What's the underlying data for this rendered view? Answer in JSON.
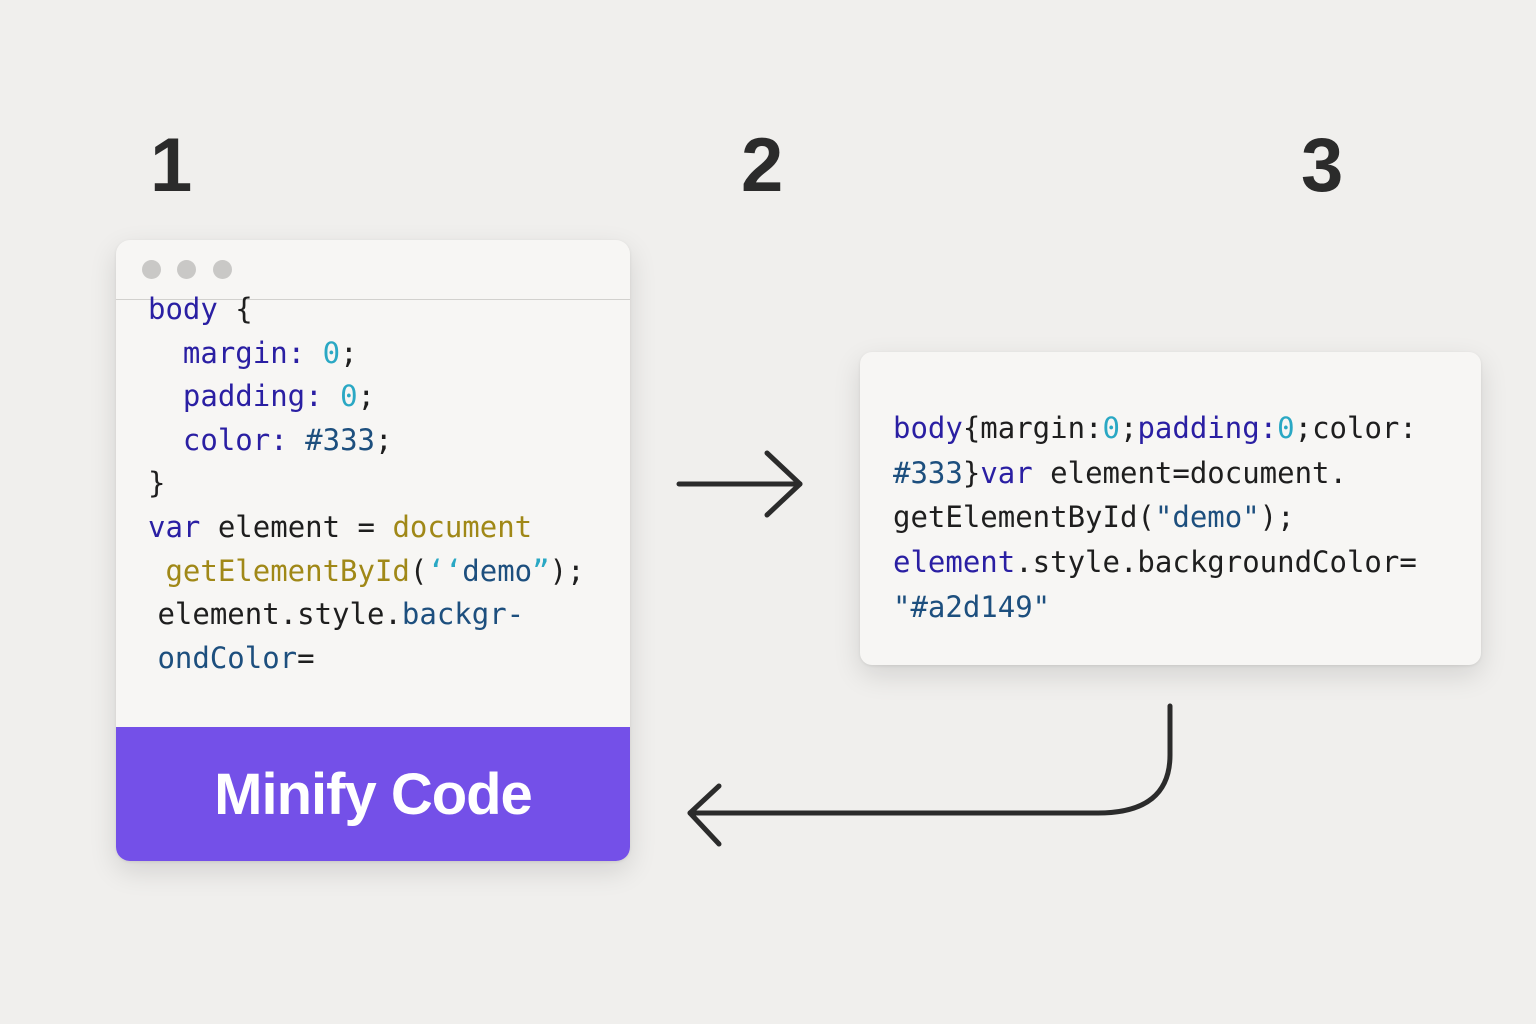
{
  "steps": [
    "1",
    "2",
    "3"
  ],
  "editor": {
    "window_dots": 3,
    "lines": [
      [
        {
          "t": "body",
          "c": "kw"
        },
        {
          "t": " {",
          "c": "plain"
        }
      ],
      [
        {
          "t": "  margin:",
          "c": "kw"
        },
        {
          "t": " 0",
          "c": "num"
        },
        {
          "t": ";",
          "c": "plain"
        }
      ],
      [
        {
          "t": "  padding:",
          "c": "kw"
        },
        {
          "t": " 0",
          "c": "num"
        },
        {
          "t": ";",
          "c": "plain"
        }
      ],
      [
        {
          "t": "  color:",
          "c": "kw"
        },
        {
          "t": " #333",
          "c": "hex"
        },
        {
          "t": ";",
          "c": "plain"
        }
      ],
      [
        {
          "t": "}",
          "c": "plain"
        }
      ],
      [
        {
          "t": "var",
          "c": "kw"
        },
        {
          "t": " element = ",
          "c": "plain"
        },
        {
          "t": "document",
          "c": "doc"
        }
      ],
      [
        {
          "t": " getElementById",
          "c": "doc"
        },
        {
          "t": "(",
          "c": "plain"
        },
        {
          "t": "‘‘",
          "c": "q"
        },
        {
          "t": "demo",
          "c": "str"
        },
        {
          "t": "”",
          "c": "q"
        },
        {
          "t": ");",
          "c": "plain"
        }
      ],
      [
        {
          "t": " element.style.",
          "c": "plain"
        },
        {
          "t": "backgr-",
          "c": "prop"
        }
      ],
      [
        {
          "t": " ondColor",
          "c": "prop"
        },
        {
          "t": "=",
          "c": "plain"
        }
      ]
    ],
    "button_label": "Minify Code"
  },
  "output": {
    "lines": [
      [
        {
          "t": "body",
          "c": "kw"
        },
        {
          "t": "{margin:",
          "c": "plain"
        },
        {
          "t": "0",
          "c": "num"
        },
        {
          "t": ";",
          "c": "plain"
        },
        {
          "t": "padding:",
          "c": "kw"
        },
        {
          "t": "0",
          "c": "num"
        },
        {
          "t": ";color:",
          "c": "plain"
        }
      ],
      [
        {
          "t": "#333",
          "c": "hex"
        },
        {
          "t": "}",
          "c": "plain"
        },
        {
          "t": "var",
          "c": "kw"
        },
        {
          "t": " element=document.",
          "c": "plain"
        }
      ],
      [
        {
          "t": "getElementById(",
          "c": "plain"
        },
        {
          "t": "\"demo\"",
          "c": "str"
        },
        {
          "t": ");",
          "c": "plain"
        }
      ],
      [
        {
          "t": "element",
          "c": "kw"
        },
        {
          "t": ".style.backgroundColor=",
          "c": "plain"
        }
      ],
      [
        {
          "t": "\"#a2d149\"",
          "c": "str"
        }
      ]
    ]
  },
  "colors": {
    "background": "#f0efed",
    "button": "#7450e8",
    "keyword": "#2a1fa3",
    "number": "#2aa8c4",
    "document": "#a08817",
    "arrow": "#2b2b2b"
  },
  "icons": [
    "arrow-right-icon",
    "curved-return-arrow-icon"
  ]
}
